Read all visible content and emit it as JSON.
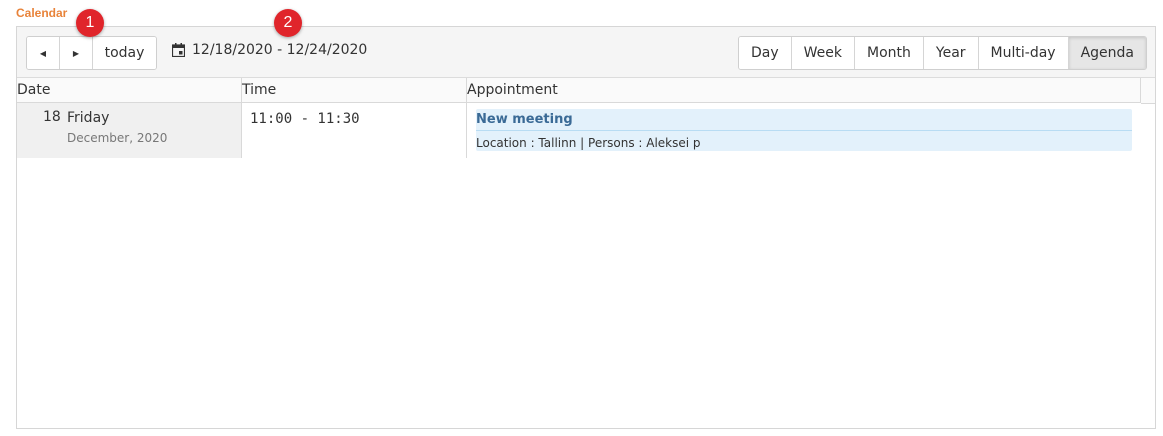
{
  "calendar_title": "Calendar",
  "nav": {
    "prev_icon": "◀",
    "next_icon": "▶",
    "today_label": "today"
  },
  "date_range": "12/18/2020 - 12/24/2020",
  "views": [
    {
      "label": "Day",
      "active": false
    },
    {
      "label": "Week",
      "active": false
    },
    {
      "label": "Month",
      "active": false
    },
    {
      "label": "Year",
      "active": false
    },
    {
      "label": "Multi-day",
      "active": false
    },
    {
      "label": "Agenda",
      "active": true
    }
  ],
  "columns": {
    "date": "Date",
    "time": "Time",
    "appointment": "Appointment"
  },
  "event": {
    "day_number": "18",
    "day_name": "Friday",
    "month_year": "December, 2020",
    "time": "11:00 - 11:30",
    "title": "New meeting",
    "details": "Location : Tallinn | Persons : Aleksei p"
  },
  "markers": [
    "1",
    "2"
  ],
  "colors": {
    "title_accent": "#e8833a",
    "event_bg": "#e3f1fb",
    "event_title": "#3a6a96",
    "marker": "#e0252b"
  }
}
